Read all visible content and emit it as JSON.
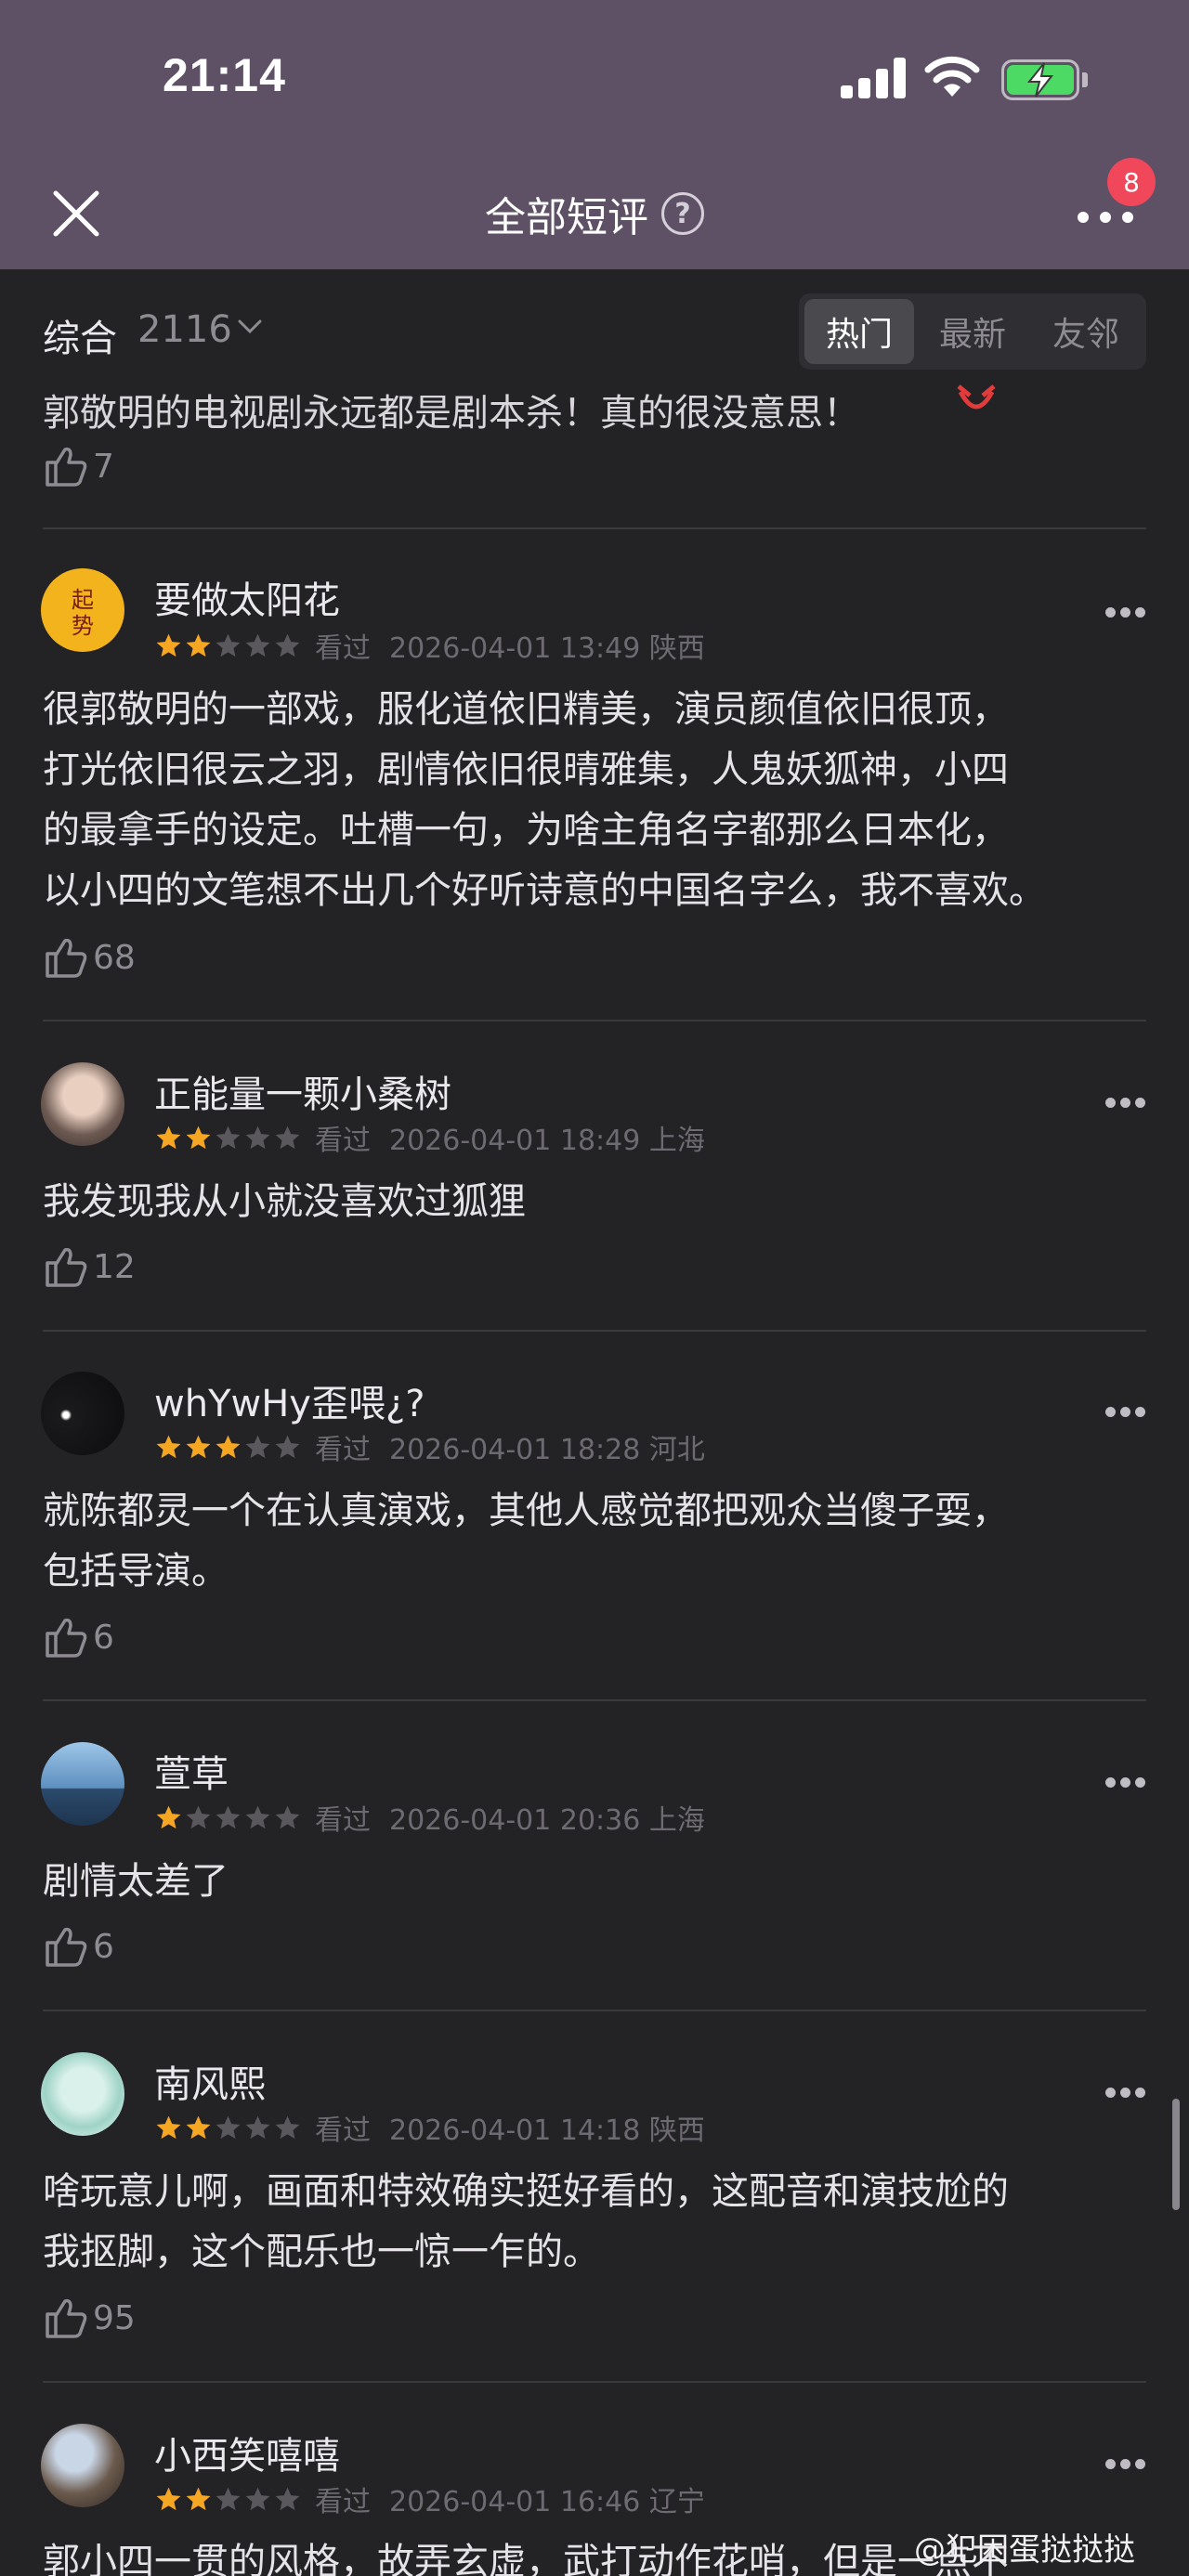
{
  "status_bar": {
    "time": "21:14",
    "icons": [
      "signal-icon",
      "wifi-icon",
      "battery-charging-icon"
    ]
  },
  "nav": {
    "title": "全部短评",
    "help_icon_text": "?",
    "notification_count": "8",
    "icons": [
      "close-icon",
      "help-icon",
      "more-icon"
    ]
  },
  "filter": {
    "sort_label": "综合",
    "count": "2116",
    "tabs": [
      "热门",
      "最新",
      "友邻"
    ],
    "active_tab": "热门"
  },
  "partial_comment": {
    "text": "郭敬明的电视剧永远都是剧本杀！真的很没意思！",
    "likes": "7"
  },
  "comments": [
    {
      "user": "要做太阳花",
      "rating": 2,
      "status": "看过",
      "date": "2026-04-01 13:49 陕西",
      "lines": [
        "很郭敬明的一部戏，服化道依旧精美，演员颜值依旧很顶，",
        "打光依旧很云之羽，剧情依旧很晴雅集，人鬼妖狐神，小四",
        "的最拿手的设定。吐槽一句，为啥主角名字都那么日本化，",
        "以小四的文笔想不出几个好听诗意的中国名字么，我不喜欢。"
      ],
      "likes": "68",
      "avatar_text": "起势"
    },
    {
      "user": "正能量一颗小桑树",
      "rating": 2,
      "status": "看过",
      "date": "2026-04-01 18:49 上海",
      "lines": [
        "我发现我从小就没喜欢过狐狸"
      ],
      "likes": "12"
    },
    {
      "user": "whYwHy歪喂¿?",
      "rating": 3,
      "status": "看过",
      "date": "2026-04-01 18:28 河北",
      "lines": [
        "就陈都灵一个在认真演戏，其他人感觉都把观众当傻子耍，",
        "包括导演。"
      ],
      "likes": "6"
    },
    {
      "user": "萱草",
      "rating": 1,
      "status": "看过",
      "date": "2026-04-01 20:36 上海",
      "lines": [
        "剧情太差了"
      ],
      "likes": "6"
    },
    {
      "user": "南风熙",
      "rating": 2,
      "status": "看过",
      "date": "2026-04-01 14:18 陕西",
      "lines": [
        "啥玩意儿啊，画面和特效确实挺好看的，这配音和演技尬的",
        "我抠脚，这个配乐也一惊一乍的。"
      ],
      "likes": "95"
    },
    {
      "user": "小西笑嘻嘻",
      "rating": 2,
      "status": "看过",
      "date": "2026-04-01 16:46 辽宁",
      "lines": [
        "郭小四一贯的风格，故弄玄虚，武打动作花哨，但是一点不"
      ],
      "likes": ""
    }
  ],
  "watermark": "@犯困蛋挞挞挞",
  "colors": {
    "header_bg": "#5e5165",
    "page_bg": "#232225",
    "star_on": "#f5a623",
    "star_off": "#5a585d",
    "badge": "#f0475a"
  }
}
